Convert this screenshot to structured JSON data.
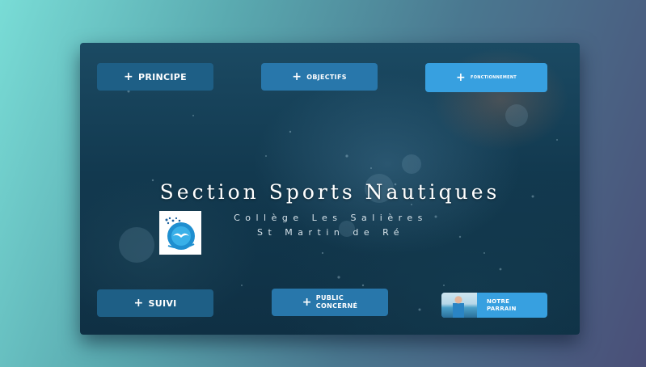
{
  "header": {
    "principe_label": "PRINCIPE",
    "objectifs_label": "OBJECTIFS",
    "fonctionnement_label": "FONCTIONNEMENT"
  },
  "hero": {
    "title": "Section Sports Nautiques",
    "subtitle_line1": "Collège Les Salières",
    "subtitle_line2": "St Martin de Ré"
  },
  "footer": {
    "suivi_label": "SUIVI",
    "public_label_line1": "PUBLIC",
    "public_label_line2": "CONCERNÉ",
    "parrain_label_line1": "NOTRE",
    "parrain_label_line2": "PARRAIN"
  },
  "icons": {
    "plus": "+"
  },
  "colors": {
    "button_dark": "#1e5f86",
    "button_mid": "#2877ab",
    "button_light": "#37a0e0"
  }
}
